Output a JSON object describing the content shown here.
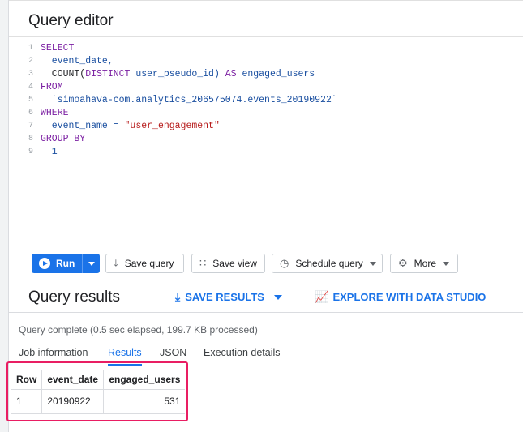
{
  "editor": {
    "title": "Query editor",
    "lines": [
      {
        "n": "1",
        "parts": [
          {
            "t": "SELECT",
            "c": "kw"
          }
        ]
      },
      {
        "n": "2",
        "parts": [
          {
            "t": "  event_date,",
            "c": "ident"
          }
        ]
      },
      {
        "n": "3",
        "parts": [
          {
            "t": "  COUNT(",
            "c": "plain"
          },
          {
            "t": "DISTINCT",
            "c": "kw"
          },
          {
            "t": " user_pseudo_id) ",
            "c": "ident"
          },
          {
            "t": "AS",
            "c": "kw"
          },
          {
            "t": " engaged_users",
            "c": "ident"
          }
        ]
      },
      {
        "n": "4",
        "parts": [
          {
            "t": "FROM",
            "c": "kw"
          }
        ]
      },
      {
        "n": "5",
        "parts": [
          {
            "t": "  `simoahava-com.analytics_206575074.events_20190922`",
            "c": "ident"
          }
        ]
      },
      {
        "n": "6",
        "parts": [
          {
            "t": "WHERE",
            "c": "kw"
          }
        ]
      },
      {
        "n": "7",
        "parts": [
          {
            "t": "  event_name = ",
            "c": "ident"
          },
          {
            "t": "\"user_engagement\"",
            "c": "str"
          }
        ]
      },
      {
        "n": "8",
        "parts": [
          {
            "t": "GROUP BY",
            "c": "kw"
          }
        ]
      },
      {
        "n": "9",
        "parts": [
          {
            "t": "  1",
            "c": "num"
          }
        ]
      }
    ]
  },
  "toolbar": {
    "run_label": "Run",
    "save_query_label": "Save query",
    "save_view_label": "Save view",
    "schedule_label": "Schedule query",
    "more_label": "More"
  },
  "results": {
    "title": "Query results",
    "save_results_label": "SAVE RESULTS",
    "explore_label": "EXPLORE WITH DATA STUDIO",
    "status": "Query complete (0.5 sec elapsed, 199.7 KB processed)",
    "tabs": [
      "Job information",
      "Results",
      "JSON",
      "Execution details"
    ],
    "active_tab": "Results",
    "table": {
      "headers": [
        "Row",
        "event_date",
        "engaged_users"
      ],
      "rows": [
        [
          "1",
          "20190922",
          "531"
        ]
      ]
    }
  },
  "colors": {
    "accent": "#1a73e8",
    "highlight_border": "#e91e63",
    "keyword": "#7b1fa2",
    "string": "#b71c1c"
  },
  "icons": [
    "play-icon",
    "save-icon",
    "view-grid-icon",
    "clock-icon",
    "gear-icon",
    "download-icon",
    "chart-icon",
    "dropdown-caret-icon"
  ]
}
